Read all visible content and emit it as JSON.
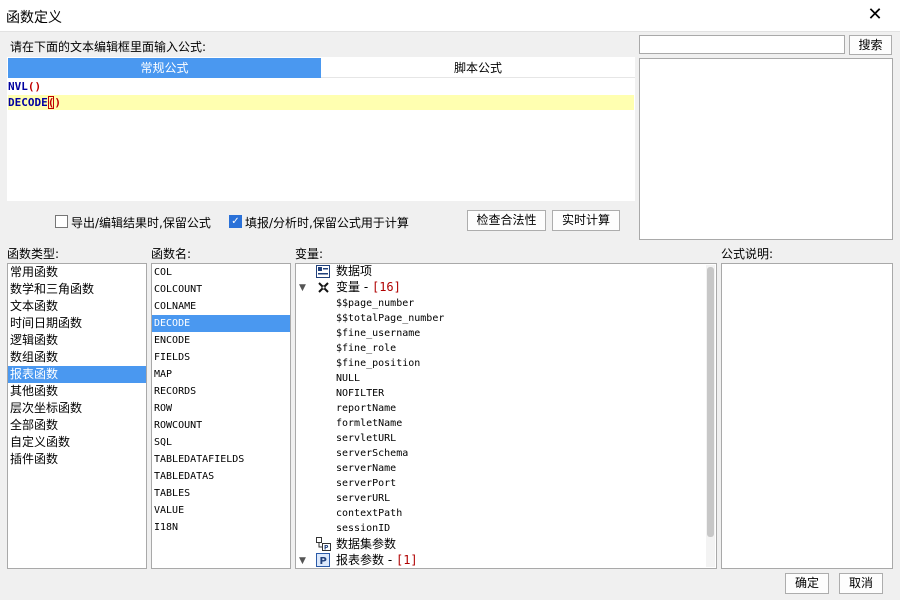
{
  "window": {
    "title": "函数定义",
    "close_glyph": "✕"
  },
  "editor": {
    "instruction": "请在下面的文本编辑框里面输入公式:",
    "tabs": [
      "常规公式",
      "脚本公式"
    ],
    "line1_kw": "NVL",
    "line1_paren": "()",
    "line2_kw": "DECODE",
    "line2_open": "(",
    "line2_close": ")"
  },
  "search": {
    "placeholder": "",
    "button": "搜索"
  },
  "options": {
    "export_keep": {
      "label": "导出/编辑结果时,保留公式",
      "checked": false
    },
    "fill_keep": {
      "label": "填报/分析时,保留公式用于计算",
      "checked": true
    },
    "check_button": "检查合法性",
    "realtime_button": "实时计算"
  },
  "function_types": {
    "header": "函数类型:",
    "items": [
      "常用函数",
      "数学和三角函数",
      "文本函数",
      "时间日期函数",
      "逻辑函数",
      "数组函数",
      "报表函数",
      "其他函数",
      "层次坐标函数",
      "全部函数",
      "自定义函数",
      "插件函数"
    ],
    "selected": "报表函数"
  },
  "function_names": {
    "header": "函数名:",
    "items": [
      "COL",
      "COLCOUNT",
      "COLNAME",
      "DECODE",
      "ENCODE",
      "FIELDS",
      "MAP",
      "RECORDS",
      "ROW",
      "ROWCOUNT",
      "SQL",
      "TABLEDATAFIELDS",
      "TABLEDATAS",
      "TABLES",
      "VALUE",
      "I18N"
    ],
    "selected": "DECODE"
  },
  "variables": {
    "header": "变量:",
    "data_items": "数据项",
    "vars_node": "变量",
    "vars_sep": " - ",
    "vars_count": "[16]",
    "vars": [
      "$$page_number",
      "$$totalPage_number",
      "$fine_username",
      "$fine_role",
      "$fine_position",
      "NULL",
      "NOFILTER",
      "reportName",
      "formletName",
      "servletURL",
      "serverSchema",
      "serverName",
      "serverPort",
      "serverURL",
      "contextPath",
      "sessionID"
    ],
    "dataset_params": "数据集参数",
    "report_params": "报表参数",
    "report_params_sep": " - ",
    "report_params_count": "[1]",
    "icons": {
      "data_items": "list-icon",
      "vars_node": "function-icon",
      "dataset": "dataset-icon",
      "report": "param-p-icon"
    }
  },
  "description": {
    "header": "公式说明:"
  },
  "footer": {
    "ok": "确定",
    "cancel": "取消"
  }
}
